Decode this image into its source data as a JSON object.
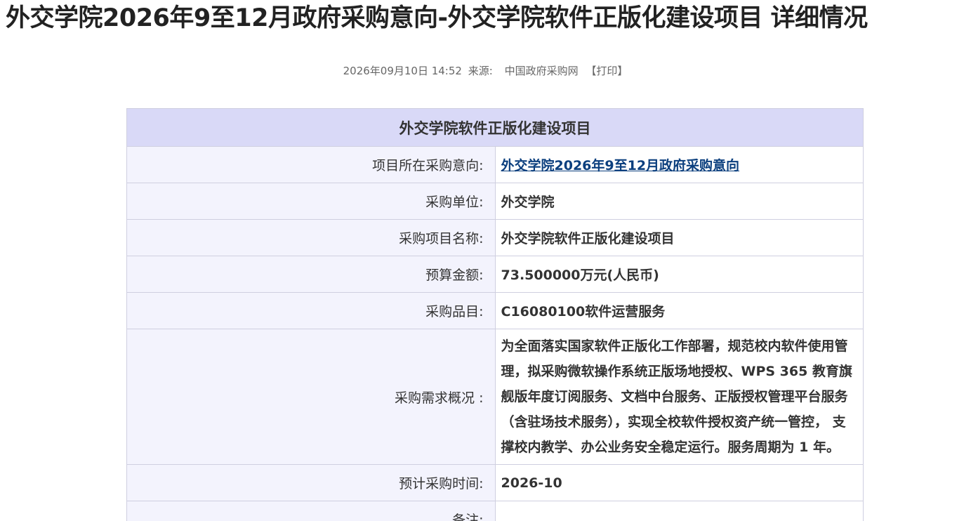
{
  "page": {
    "title": "外交学院2026年9至12月政府采购意向-外交学院软件正版化建设项目 详细情况",
    "date": "2026年09月10日 14:52",
    "source_label": "来源:",
    "source_value": "中国政府采购网",
    "print_label": "【打印】"
  },
  "table": {
    "heading": "外交学院软件正版化建设项目",
    "rows": [
      {
        "label": "项目所在采购意向:",
        "value": "外交学院2026年9至12月政府采购意向",
        "link": true
      },
      {
        "label": "采购单位:",
        "value": "外交学院"
      },
      {
        "label": "采购项目名称:",
        "value": "外交学院软件正版化建设项目"
      },
      {
        "label": "预算金额:",
        "value": "73.500000万元(人民币)"
      },
      {
        "label": "采购品目:",
        "value": "C16080100软件运营服务"
      },
      {
        "label": "采购需求概况 :",
        "value": "为全面落实国家软件正版化工作部署，规范校内软件使用管理，拟采购微软操作系统正版场地授权、WPS 365 教育旗舰版年度订阅服务、文档中台服务、正版授权管理平台服务（含驻场技术服务），实现全校软件授权资产统一管控， 支撑校内教学、办公业务安全稳定运行。服务周期为 1 年。"
      },
      {
        "label": "预计采购时间:",
        "value": "2026-10"
      },
      {
        "label": "备注:",
        "value": ""
      }
    ]
  },
  "colors": {
    "header_bg": "#d9d9f7",
    "label_bg": "#f3f3fd",
    "border": "#cfcfe0",
    "link": "#0b3f7e"
  }
}
